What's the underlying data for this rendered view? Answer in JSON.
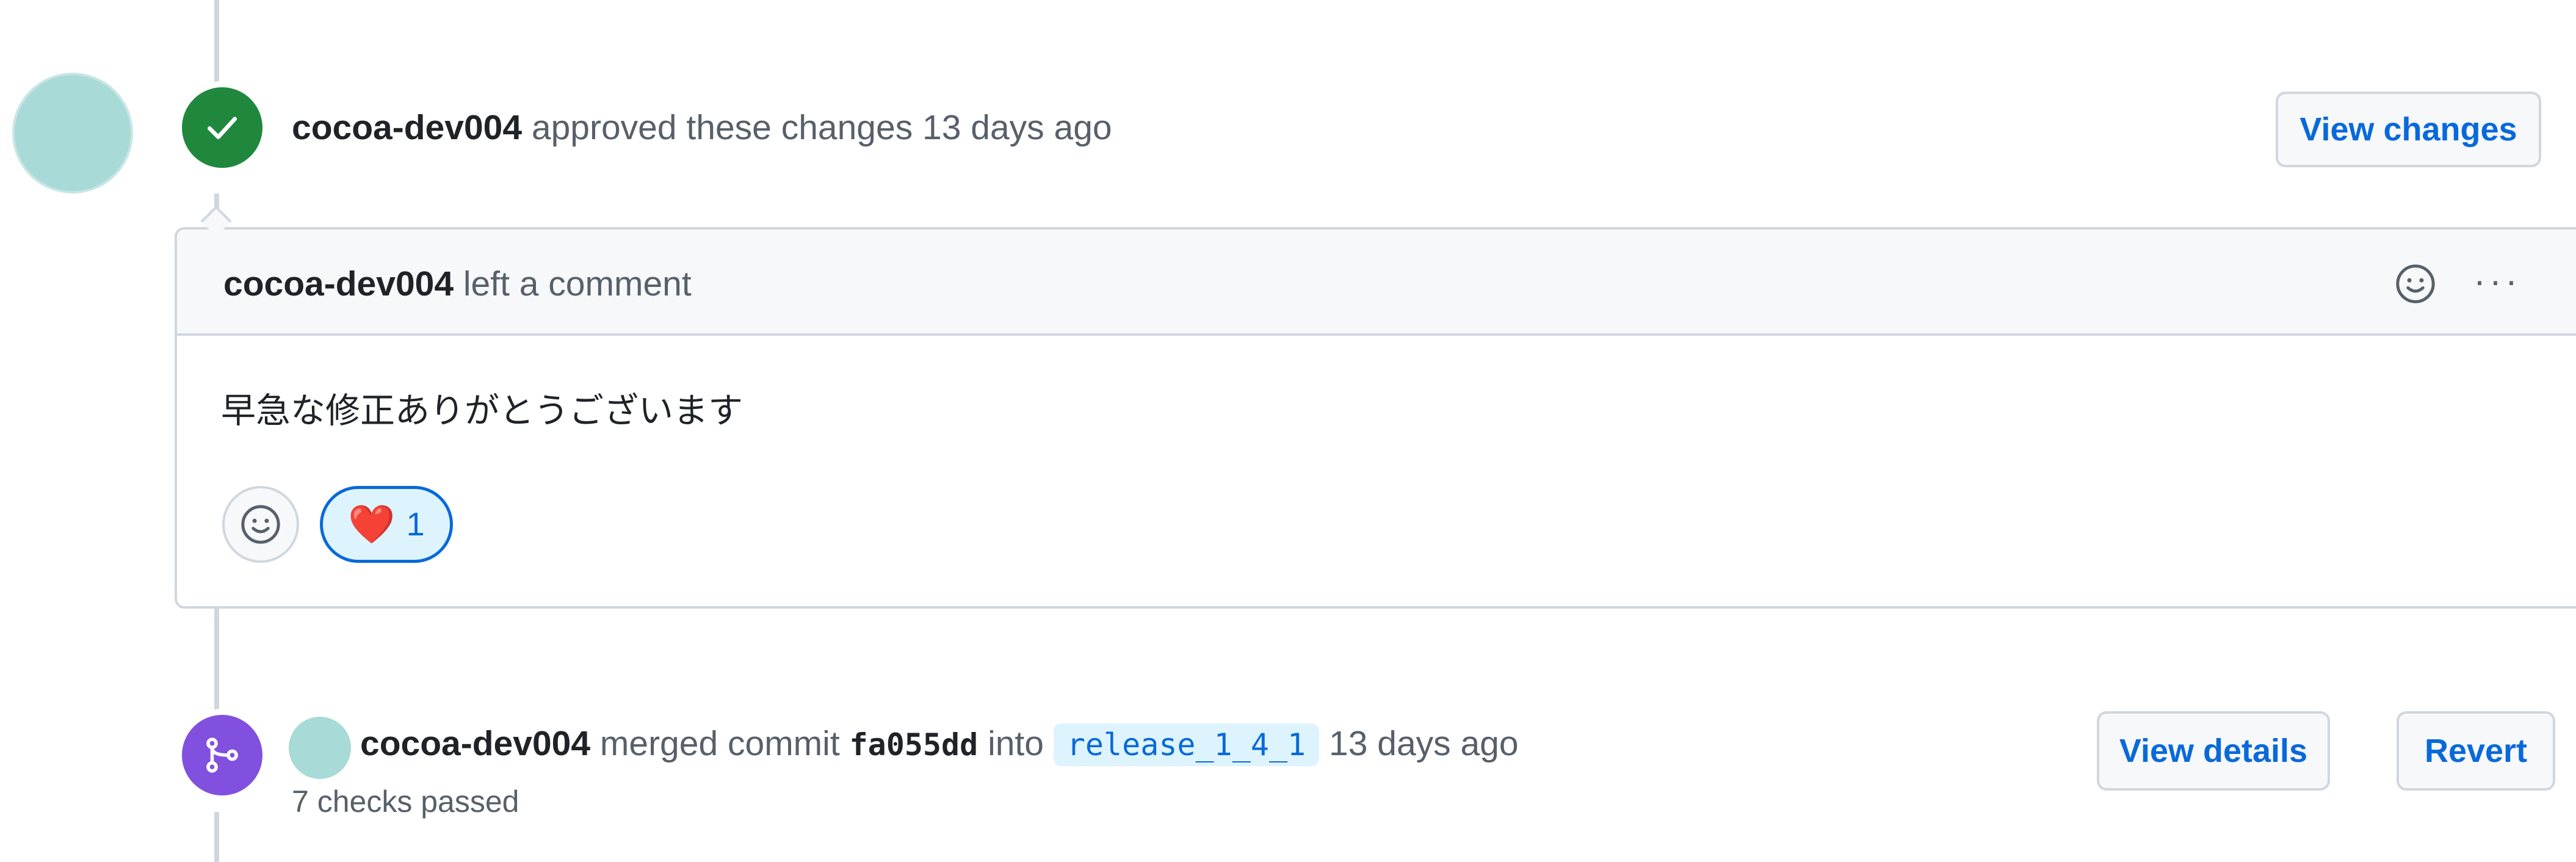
{
  "approval_event": {
    "author": "cocoa-dev004",
    "action_text": "approved these changes",
    "time": "13 days ago",
    "view_changes_label": "View changes",
    "badge_icon": "check-icon",
    "badge_color": "#1f883d"
  },
  "comment": {
    "author": "cocoa-dev004",
    "header_text": "left a comment",
    "body": "早急な修正ありがとうございます",
    "reactions": [
      {
        "emoji": "❤️",
        "count": "1",
        "icon": "heart-icon"
      }
    ],
    "add_reaction_icon": "smiley-icon",
    "more_icon": "kebab-horizontal-icon"
  },
  "merge_event": {
    "author": "cocoa-dev004",
    "merged_text": "merged commit",
    "commit_sha": "fa055dd",
    "into_text": "into",
    "branch": "release_1_4_1",
    "time": "13 days ago",
    "checks_text": "7 checks passed",
    "view_details_label": "View details",
    "revert_label": "Revert",
    "badge_icon": "git-merge-icon",
    "badge_color": "#8250df"
  },
  "colors": {
    "link_blue": "#0969da",
    "muted_text": "#57606a",
    "border": "#d0d7de",
    "avatar_teal": "#a8dad7"
  }
}
